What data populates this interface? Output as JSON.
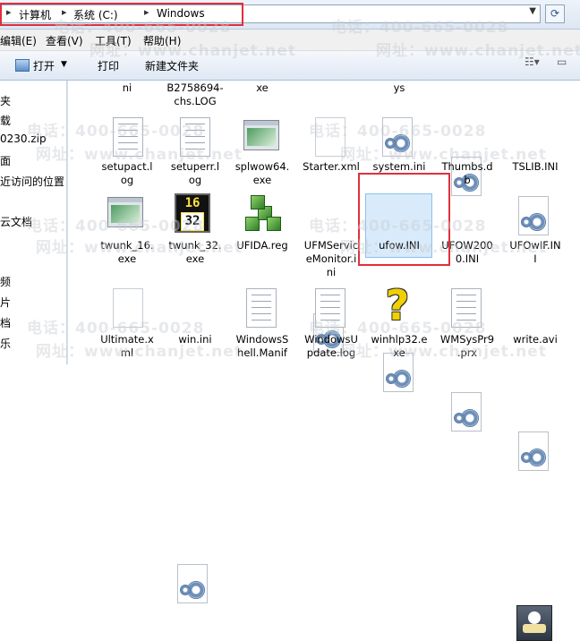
{
  "address": {
    "crumbs": [
      "计算机",
      "系统 (C:)",
      "Windows"
    ],
    "refresh_icon": "refresh-icon"
  },
  "menu": [
    "编辑(E)",
    "查看(V)",
    "工具(T)",
    "帮助(H)"
  ],
  "toolbar": {
    "open": "打开",
    "print": "打印",
    "new_folder": "新建文件夹"
  },
  "nav": [
    "夹",
    "载",
    "0230.zip",
    "面",
    "近访问的位置",
    "云文档",
    "频",
    "片",
    "档",
    "乐"
  ],
  "files": [
    {
      "name": "ni",
      "icon": "text-file-icon"
    },
    {
      "name": "B2758694-chs.LOG",
      "icon": "text-file-icon"
    },
    {
      "name": "xe",
      "icon": "exe-icon"
    },
    {
      "name": "ys",
      "icon": "folder-icon"
    },
    {
      "name": "setupact.log",
      "icon": "text-file-icon"
    },
    {
      "name": "setuperr.log",
      "icon": "text-file-icon"
    },
    {
      "name": "splwow64.exe",
      "icon": "exe-icon"
    },
    {
      "name": "Starter.xml",
      "icon": "xml-file-icon"
    },
    {
      "name": "system.ini",
      "icon": "ini-file-icon"
    },
    {
      "name": "Thumbs.db",
      "icon": "ini-file-icon"
    },
    {
      "name": "TSLIB.INI",
      "icon": "ini-file-icon"
    },
    {
      "name": "twunk_16.exe",
      "icon": "exe-icon"
    },
    {
      "name": "twunk_32.exe",
      "icon": "clock-exe-icon"
    },
    {
      "name": "UFIDA.reg",
      "icon": "registry-file-icon"
    },
    {
      "name": "UFMServiceMonitor.ini",
      "icon": "ini-file-icon"
    },
    {
      "name": "ufow.INI",
      "icon": "ini-file-icon",
      "selected": true
    },
    {
      "name": "UFOW2000.INI",
      "icon": "ini-file-icon"
    },
    {
      "name": "UFOwIF.INI",
      "icon": "ini-file-icon"
    },
    {
      "name": "Ultimate.xml",
      "icon": "xml-file-icon"
    },
    {
      "name": "win.ini",
      "icon": "ini-file-icon"
    },
    {
      "name": "WindowsShell.Manifest",
      "icon": "text-file-icon"
    },
    {
      "name": "WindowsUpdate.log",
      "icon": "text-file-icon"
    },
    {
      "name": "winhlp32.exe",
      "icon": "help-exe-icon"
    },
    {
      "name": "WMSysPr9.prx",
      "icon": "text-file-icon"
    },
    {
      "name": "write.avi",
      "icon": "video-file-icon"
    }
  ],
  "labels": {
    "r0": [
      "ni",
      "B2758694-",
      "chs.LOG",
      "xe",
      "ys"
    ],
    "r1": [
      "setupact.l",
      "og",
      "setuperr.l",
      "og",
      "splwow64.",
      "exe",
      "Starter.xml",
      "system.ini",
      "Thumbs.d",
      "b",
      "TSLIB.INI"
    ],
    "r2": [
      "twunk_16.",
      "exe",
      "twunk_32.",
      "exe",
      "UFIDA.reg",
      "UFMServic",
      "eMonitor.i",
      "ni",
      "ufow.INI",
      "UFOW200",
      "0.INI",
      "UFOwIF.IN",
      "I"
    ],
    "r3": [
      "Ultimate.x",
      "ml",
      "win.ini",
      "WindowsS",
      "hell.Manif",
      "WindowsU",
      "pdate.log",
      "winhlp32.e",
      "xe",
      "WMSysPr9",
      ".prx",
      "write.avi"
    ]
  },
  "clock_digits": [
    "16",
    "32"
  ],
  "watermark": {
    "phone": "电话：400-665-0028",
    "web": "网址：www.chanjet.net"
  },
  "colors": {
    "highlight": "#e0303a",
    "selection": "#d9ebfb"
  }
}
